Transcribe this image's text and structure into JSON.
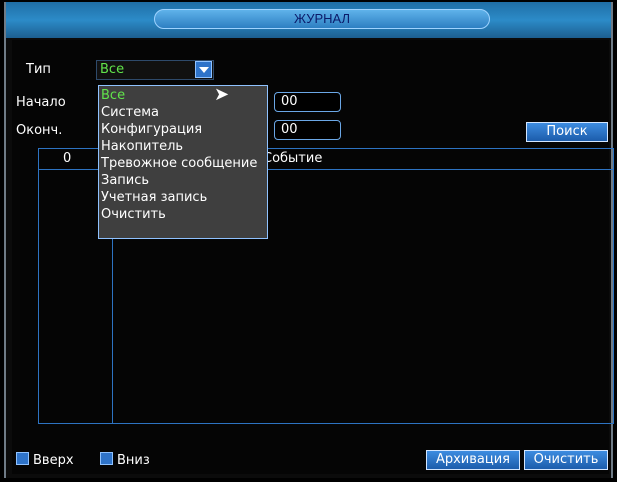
{
  "window": {
    "title": "ЖУРНАЛ"
  },
  "filters": {
    "type_label": "Тип",
    "type_value": "Все",
    "start_label": "Начало",
    "start_value": "00",
    "end_label": "Оконч.",
    "end_value": "00",
    "search_button": "Поиск"
  },
  "dropdown": {
    "items": [
      "Все",
      "Система",
      "Конфигурация",
      "Накопитель",
      "Тревожное сообщение",
      "Запись",
      "Учетная запись",
      "Очистить"
    ]
  },
  "table": {
    "columns": [
      "0",
      "Событие"
    ]
  },
  "footer": {
    "up_label": "Вверх",
    "down_label": "Вниз",
    "archive_button": "Архивация",
    "clear_button": "Очистить"
  }
}
